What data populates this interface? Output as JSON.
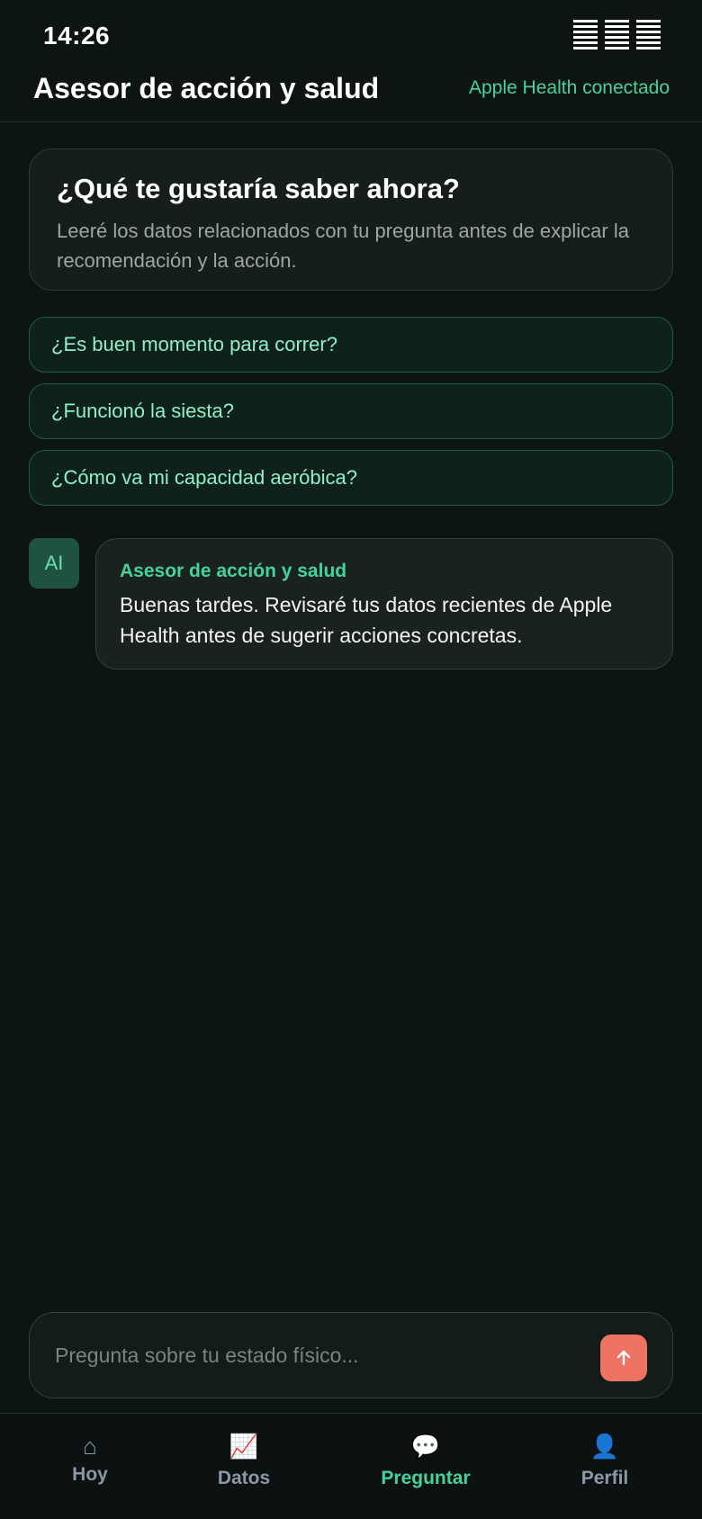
{
  "status_bar": {
    "time": "14:26"
  },
  "header": {
    "title": "Asesor de acción y salud",
    "health_status": "Apple Health conectado"
  },
  "intro": {
    "title": "¿Qué te gustaría saber ahora?",
    "text": "Leeré los datos relacionados con tu pregunta antes de explicar la recomendación y la acción."
  },
  "suggestions": [
    "¿Es buen momento para correr?",
    "¿Funcionó la siesta?",
    "¿Cómo va mi capacidad aeróbica?"
  ],
  "message": {
    "avatar": "AI",
    "author": "Asesor de acción y salud",
    "text": "Buenas tardes. Revisaré tus datos recientes de Apple Health antes de sugerir acciones concretas."
  },
  "composer": {
    "placeholder": "Pregunta sobre tu estado físico..."
  },
  "tabs": [
    {
      "icon": "⌂",
      "label": "Hoy",
      "active": false
    },
    {
      "icon": "📈",
      "label": "Datos",
      "active": false
    },
    {
      "icon": "💬",
      "label": "Preguntar",
      "active": true
    },
    {
      "icon": "👤",
      "label": "Perfil",
      "active": false
    }
  ],
  "colors": {
    "background": "#0c1513",
    "accent": "#45d39c",
    "send_button": "#ef7362"
  }
}
